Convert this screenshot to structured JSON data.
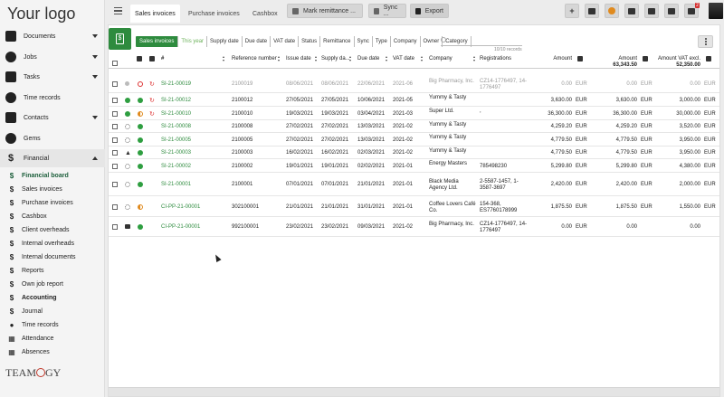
{
  "logo": "Your logo",
  "brand": {
    "name_left": "TEAM",
    "name_right": "GY",
    "accent": "#2e8b3e"
  },
  "sidebar": {
    "main": [
      {
        "label": "Documents",
        "icon": "documents-icon"
      },
      {
        "label": "Jobs",
        "icon": "jobs-icon"
      },
      {
        "label": "Tasks",
        "icon": "tasks-icon"
      },
      {
        "label": "Time records",
        "icon": "clock-icon"
      },
      {
        "label": "Contacts",
        "icon": "contacts-icon"
      },
      {
        "label": "Gems",
        "icon": "gem-icon"
      },
      {
        "label": "Financial",
        "icon": "dollar-icon"
      }
    ],
    "sub": [
      "Financial board",
      "Sales invoices",
      "Purchase invoices",
      "Cashbox",
      "Client overheads",
      "Internal overheads",
      "Internal documents",
      "Reports",
      "Own job report",
      "Accounting",
      "Journal",
      "Time records",
      "Attendance",
      "Absences"
    ]
  },
  "topbar": {
    "tabs": [
      "Sales invoices",
      "Purchase invoices",
      "Cashbox"
    ],
    "mark_remittance": "Mark remittance ...",
    "sync": "Sync ...",
    "export": "Export",
    "add": "+",
    "notifications_count": "2"
  },
  "filters": [
    "Sales invoices",
    "This year",
    "Supply date",
    "Due date",
    "VAT date",
    "Status",
    "Remittance",
    "Sync",
    "Type",
    "Company",
    "Owner",
    "Category"
  ],
  "search": {
    "placeholder": "",
    "count": "10/10 records"
  },
  "table": {
    "headers": {
      "number": "#",
      "reg": "Reference number",
      "issue": "Issue date",
      "supply": "Supply da...",
      "due": "Due date",
      "vat": "VAT date",
      "company": "Company",
      "registrations": "Registrations",
      "amount": "Amount",
      "amount2": "Amount",
      "amount_vat": "Amount VAT excl."
    },
    "totals": {
      "amount": "63,343.50",
      "amount_vat": "52,350.00"
    },
    "rows": [
      {
        "num": "SI-21-00019",
        "ref": "2100019",
        "issue": "08/06/2021",
        "supply": "08/06/2021",
        "due": "22/06/2021",
        "vat": "2021-06",
        "company": "Big Pharmacy, Inc.",
        "reg": "CZ14-1776497, 14-1776497",
        "amount": "0.00",
        "cur": "EUR",
        "amount2": "0.00",
        "cur2": "EUR",
        "vat_excl": "0.00",
        "cur3": "EUR"
      },
      {
        "num": "SI-21-00012",
        "ref": "2100012",
        "issue": "27/05/2021",
        "supply": "27/05/2021",
        "due": "10/06/2021",
        "vat": "2021-05",
        "company": "Yummy & Tasty",
        "reg": "",
        "amount": "3,630.00",
        "cur": "EUR",
        "amount2": "3,630.00",
        "cur2": "EUR",
        "vat_excl": "3,000.00",
        "cur3": "EUR"
      },
      {
        "num": "SI-21-00010",
        "ref": "2100010",
        "issue": "19/03/2021",
        "supply": "19/03/2021",
        "due": "03/04/2021",
        "vat": "2021-03",
        "company": "Super Ltd.",
        "reg": ",",
        "amount": "36,300.00",
        "cur": "EUR",
        "amount2": "36,300.00",
        "cur2": "EUR",
        "vat_excl": "30,000.00",
        "cur3": "EUR"
      },
      {
        "num": "SI-21-00008",
        "ref": "2100008",
        "issue": "27/02/2021",
        "supply": "27/02/2021",
        "due": "13/03/2021",
        "vat": "2021-02",
        "company": "Yummy & Tasty",
        "reg": "",
        "amount": "4,259.20",
        "cur": "EUR",
        "amount2": "4,259.20",
        "cur2": "EUR",
        "vat_excl": "3,520.00",
        "cur3": "EUR"
      },
      {
        "num": "SI-21-00005",
        "ref": "2100005",
        "issue": "27/02/2021",
        "supply": "27/02/2021",
        "due": "13/03/2021",
        "vat": "2021-02",
        "company": "Yummy & Tasty",
        "reg": "",
        "amount": "4,779.50",
        "cur": "EUR",
        "amount2": "4,779.50",
        "cur2": "EUR",
        "vat_excl": "3,950.00",
        "cur3": "EUR"
      },
      {
        "num": "SI-21-00003",
        "ref": "2100003",
        "issue": "16/02/2021",
        "supply": "16/02/2021",
        "due": "02/03/2021",
        "vat": "2021-02",
        "company": "Yummy & Tasty",
        "reg": "",
        "amount": "4,779.50",
        "cur": "EUR",
        "amount2": "4,779.50",
        "cur2": "EUR",
        "vat_excl": "3,950.00",
        "cur3": "EUR"
      },
      {
        "num": "SI-21-00002",
        "ref": "2100002",
        "issue": "19/01/2021",
        "supply": "19/01/2021",
        "due": "02/02/2021",
        "vat": "2021-01",
        "company": "Energy Masters",
        "reg": "785498230",
        "amount": "5,299.80",
        "cur": "EUR",
        "amount2": "5,299.80",
        "cur2": "EUR",
        "vat_excl": "4,380.00",
        "cur3": "EUR"
      },
      {
        "num": "SI-21-00001",
        "ref": "2100001",
        "issue": "07/01/2021",
        "supply": "07/01/2021",
        "due": "21/01/2021",
        "vat": "2021-01",
        "company": "Black Media Agency Ltd.",
        "reg": "2-5587-1457, 1-3587-3697",
        "amount": "2,420.00",
        "cur": "EUR",
        "amount2": "2,420.00",
        "cur2": "EUR",
        "vat_excl": "2,000.00",
        "cur3": "EUR"
      },
      {
        "num": "CI-PP-21-00001",
        "ref": "302100001",
        "issue": "21/01/2021",
        "supply": "21/01/2021",
        "due": "31/01/2021",
        "vat": "2021-01",
        "company": "Coffee Lovers Café Co.",
        "reg": "154-368, ES7760178999",
        "amount": "1,875.50",
        "cur": "EUR",
        "amount2": "1,875.50",
        "cur2": "EUR",
        "vat_excl": "1,550.00",
        "cur3": "EUR"
      },
      {
        "num": "CI-PP-21-00001",
        "ref": "992100001",
        "issue": "23/02/2021",
        "supply": "23/02/2021",
        "due": "09/03/2021",
        "vat": "2021-02",
        "company": "Big Pharmacy, Inc.",
        "reg": "CZ14-1776497, 14-1776497",
        "amount": "0.00",
        "cur": "EUR",
        "amount2": "0.00",
        "cur2": "",
        "vat_excl": "0.00",
        "cur3": ""
      }
    ]
  }
}
